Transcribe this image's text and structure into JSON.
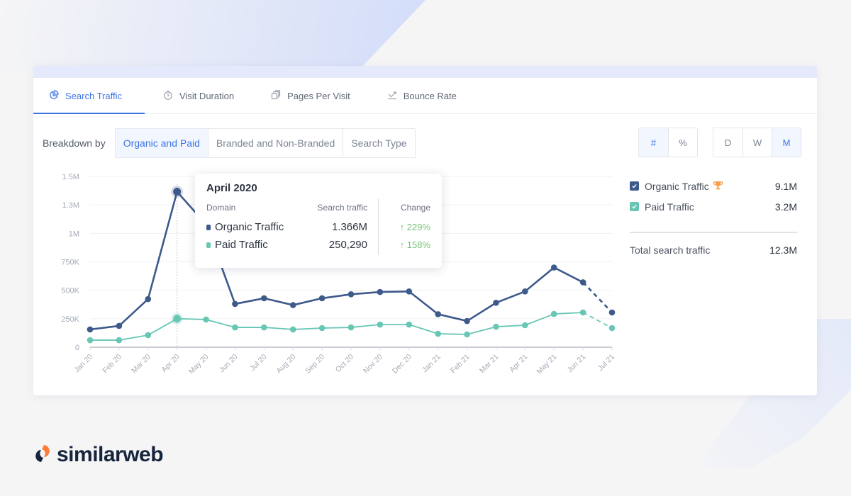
{
  "tabs": [
    {
      "label": "Search Traffic",
      "icon": "pie-chart-icon",
      "active": true
    },
    {
      "label": "Visit Duration",
      "icon": "stopwatch-icon",
      "active": false
    },
    {
      "label": "Pages Per Visit",
      "icon": "pages-icon",
      "active": false
    },
    {
      "label": "Bounce Rate",
      "icon": "bounce-icon",
      "active": false
    }
  ],
  "breakdown": {
    "label": "Breakdown by",
    "options": [
      "Organic and Paid",
      "Branded and Non-Branded",
      "Search Type"
    ],
    "selected": "Organic and Paid"
  },
  "unit_toggle": {
    "options": [
      "#",
      "%"
    ],
    "selected": "#"
  },
  "period_toggle": {
    "options": [
      "D",
      "W",
      "M"
    ],
    "selected": "M"
  },
  "legend": {
    "items": [
      {
        "label": "Organic Traffic",
        "value": "9.1M",
        "color": "#3d5a8a",
        "badge": "trophy-icon"
      },
      {
        "label": "Paid Traffic",
        "value": "3.2M",
        "color": "#67c6b4"
      }
    ],
    "total_label": "Total search traffic",
    "total_value": "12.3M"
  },
  "tooltip": {
    "title": "April 2020",
    "headers": [
      "Domain",
      "Search traffic",
      "Change"
    ],
    "rows": [
      {
        "label": "Organic Traffic",
        "value": "1.366M",
        "change": "229%"
      },
      {
        "label": "Paid Traffic",
        "value": "250,290",
        "change": "158%"
      }
    ]
  },
  "chart_data": {
    "type": "line",
    "title": "Search Traffic",
    "xlabel": "",
    "ylabel": "",
    "x": [
      "Jan 20",
      "Feb 20",
      "Mar 20",
      "Apr 20",
      "May 20",
      "Jun 20",
      "Jul 20",
      "Aug 20",
      "Sep 20",
      "Oct 20",
      "Nov 20",
      "Dec 20",
      "Jan 21",
      "Feb 21",
      "Mar 21",
      "Apr 21",
      "May 21",
      "Jun 21",
      "Jul 21"
    ],
    "yticks": [
      {
        "value": 0,
        "label": "0"
      },
      {
        "value": 250000,
        "label": "250K"
      },
      {
        "value": 500000,
        "label": "500K"
      },
      {
        "value": 750000,
        "label": "750K"
      },
      {
        "value": 1000000,
        "label": "1M"
      },
      {
        "value": 1250000,
        "label": "1.3M"
      },
      {
        "value": 1500000,
        "label": "1.5M"
      }
    ],
    "ylim": [
      0,
      1500000
    ],
    "grid": true,
    "legend_position": "right",
    "highlighted_index": 3,
    "projected_last_point": true,
    "series": [
      {
        "name": "Organic Traffic",
        "color": "#3d5a8a",
        "values": [
          156000,
          187000,
          423000,
          1366000,
          1080000,
          380000,
          430000,
          370000,
          430000,
          465000,
          485000,
          490000,
          290000,
          230000,
          390000,
          490000,
          700000,
          570000,
          305000
        ]
      },
      {
        "name": "Paid Traffic",
        "color": "#67c6b4",
        "values": [
          62000,
          62000,
          106000,
          250290,
          243000,
          174000,
          174000,
          156000,
          168000,
          174000,
          199000,
          199000,
          118000,
          112000,
          180000,
          193000,
          292000,
          305000,
          168000
        ]
      }
    ]
  },
  "brand": {
    "name": "similarweb"
  }
}
